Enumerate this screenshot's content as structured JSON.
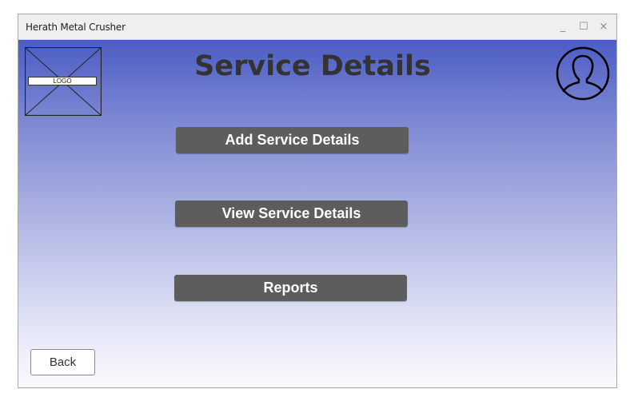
{
  "window": {
    "title": "Herath Metal Crusher",
    "minimize_glyph": "_",
    "maximize_glyph": "☐",
    "close_glyph": "×"
  },
  "header": {
    "logo_label": "LOGO",
    "page_title": "Service Details",
    "avatar_icon": "user-avatar-icon"
  },
  "menu": {
    "add_label": "Add Service Details",
    "view_label": "View Service  Details",
    "reports_label": "Reports"
  },
  "footer": {
    "back_label": "Back"
  },
  "colors": {
    "gradient_top": "#4b5cc4",
    "gradient_bottom": "#fbfbfe",
    "button_bg": "#5d5d5d",
    "title_text": "#333333"
  }
}
